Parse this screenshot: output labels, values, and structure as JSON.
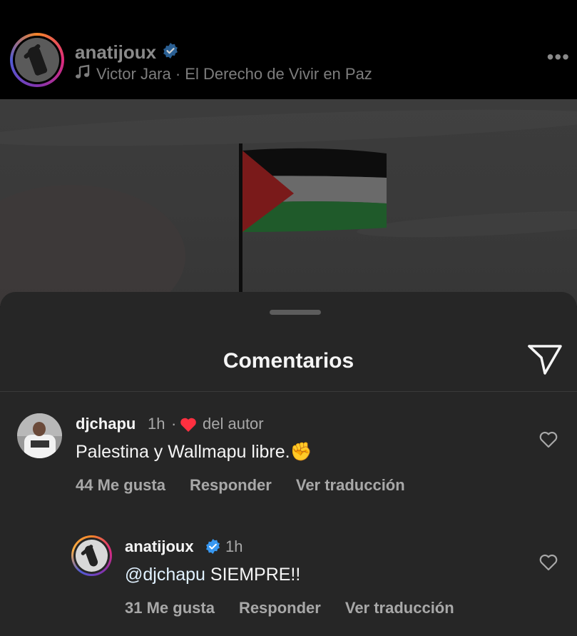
{
  "header": {
    "username": "anatijoux",
    "music_icon": "music-note-icon",
    "song": "Victor Jara · El Derecho de Vivir en Paz",
    "more_icon": "more-options-icon",
    "more_label": "•••"
  },
  "post": {
    "image": "palestine-flag-drawing"
  },
  "sheet": {
    "title": "Comentarios",
    "send_icon": "send-icon"
  },
  "comments": [
    {
      "username": "djchapu",
      "time": "1h",
      "separator": "·",
      "liked_by_author_label": "del autor",
      "text": "Palestina y Wallmapu libre.",
      "emoji": "✊",
      "likes": "44 Me gusta",
      "reply_label": "Responder",
      "translate_label": "Ver traducción"
    },
    {
      "username": "anatijoux",
      "time": "1h",
      "mention": "@djchapu",
      "text": " SIEMPRE!!",
      "likes": "31 Me gusta",
      "reply_label": "Responder",
      "translate_label": "Ver traducción"
    }
  ],
  "colors": {
    "verified": "#3797f0",
    "author_heart": "#ff3040",
    "mention": "#e0f1ff",
    "flag_red": "#7a1a1a",
    "flag_green": "#1f5a2a",
    "flag_black": "#0d0d0d"
  }
}
